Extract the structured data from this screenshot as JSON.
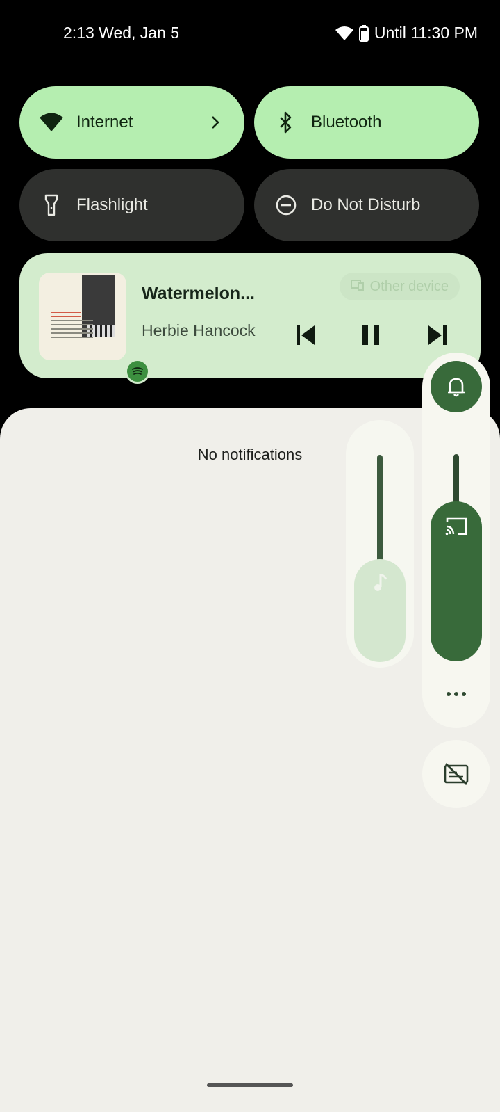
{
  "status_bar": {
    "time_date": "2:13 Wed, Jan 5",
    "battery_text": "Until 11:30 PM",
    "icons": [
      "wifi-icon",
      "battery-icon"
    ]
  },
  "quick_settings": {
    "tiles": [
      {
        "label": "Internet",
        "state": "on",
        "icon": "wifi-icon",
        "has_chevron": true
      },
      {
        "label": "Bluetooth",
        "state": "on",
        "icon": "bluetooth-icon"
      },
      {
        "label": "Flashlight",
        "state": "off",
        "icon": "flashlight-icon"
      },
      {
        "label": "Do Not Disturb",
        "state": "off",
        "icon": "do-not-disturb-icon"
      }
    ]
  },
  "media": {
    "title": "Watermelon...",
    "artist": "Herbie Hancock",
    "output_device": "Other device",
    "app_icon": "spotify-icon",
    "controls": [
      "previous-icon",
      "pause-icon",
      "next-icon"
    ]
  },
  "notifications": {
    "empty_text": "No notifications"
  },
  "volume": {
    "ringer_icon": "bell-icon",
    "cast_level": 0.7,
    "media_level": 0.48,
    "more_icon": "more-horizontal-icon",
    "captions_icon": "captions-off-icon"
  },
  "colors": {
    "tile_on": "#b5eeb0",
    "tile_off": "#2f302e",
    "media_card": "#d3eccd",
    "shade": "#f0efea",
    "accent": "#386a3a"
  }
}
